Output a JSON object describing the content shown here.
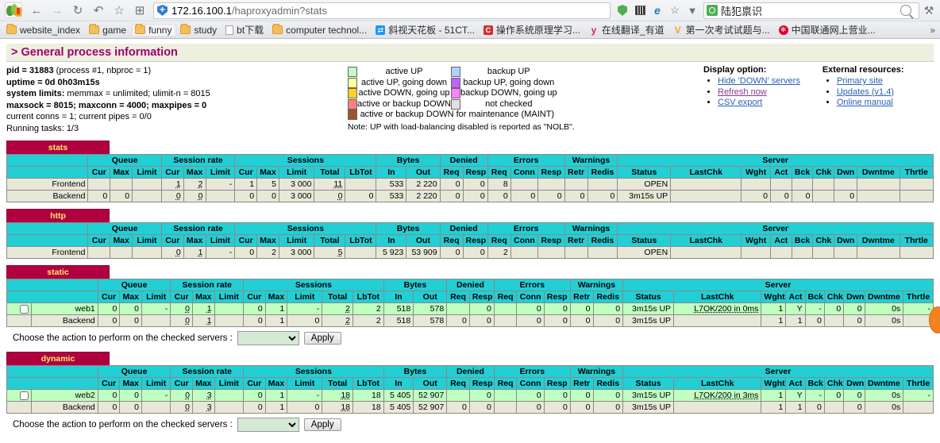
{
  "browser": {
    "nav": {
      "back": "←",
      "forward": "→",
      "reload": "↻",
      "undo": "↶",
      "star": "☆",
      "apps": "⊞"
    },
    "url_host": "172.16.100.1",
    "url_path": "/haproxyadmin?stats",
    "search_value": "陆犯禀识",
    "dropdown_caret": "▼",
    "wrench": "⚒",
    "overflow": "»",
    "bookmarks": [
      {
        "label": "website_index",
        "icon": "folder-icon",
        "selected": false
      },
      {
        "label": "game",
        "icon": "folder-icon",
        "selected": false
      },
      {
        "label": "funny",
        "icon": "folder-icon",
        "selected": true
      },
      {
        "label": "study",
        "icon": "folder-icon",
        "selected": false
      },
      {
        "label": "bt下载",
        "icon": "page-icon",
        "selected": false
      },
      {
        "label": "computer technol...",
        "icon": "folder-icon",
        "selected": false
      },
      {
        "label": "斜视天花板 - 51CT...",
        "icon": "favicon-blue",
        "selected": false
      },
      {
        "label": "操作系统原理学习...",
        "icon": "favicon-red",
        "selected": false
      },
      {
        "label": "在线翻译_有道",
        "icon": "favicon-youdao",
        "selected": false
      },
      {
        "label": "第一次考试试题与...",
        "icon": "favicon-v",
        "selected": false
      },
      {
        "label": "中国联通网上营业...",
        "icon": "favicon-unicom",
        "selected": false
      }
    ]
  },
  "page": {
    "section_title": "> General process information",
    "process_info": [
      {
        "bold": "pid = 31883",
        "rest": " (process #1, nbproc = 1)"
      },
      {
        "bold": "uptime = 0d 0h03m15s",
        "rest": ""
      },
      {
        "bold": "system limits:",
        "rest": " memmax = unlimited; ulimit-n = 8015"
      },
      {
        "bold": "maxsock = 8015; maxconn = 4000; maxpipes = 0",
        "rest": ""
      },
      {
        "bold": "",
        "rest": "current conns = 1; current pipes = 0/0"
      },
      {
        "bold": "",
        "rest": "Running tasks: 1/3"
      }
    ],
    "legend": {
      "left": [
        {
          "color": "#c0ffc0",
          "label": "active UP"
        },
        {
          "color": "#ffffa0",
          "label": "active UP, going down"
        },
        {
          "color": "#ffd020",
          "label": "active DOWN, going up"
        },
        {
          "color": "#ff8080",
          "label": "active or backup DOWN"
        },
        {
          "color": "#a0522d",
          "label": "active or backup DOWN for maintenance (MAINT)"
        }
      ],
      "right": [
        {
          "color": "#b0d0ff",
          "label": "backup UP"
        },
        {
          "color": "#c060ff",
          "label": "backup UP, going down"
        },
        {
          "color": "#ff80ff",
          "label": "backup DOWN, going up"
        },
        {
          "color": "#e0e0e0",
          "label": "not checked"
        }
      ],
      "note": "Note: UP with load-balancing disabled is reported as \"NOLB\"."
    },
    "display_option": {
      "title": "Display option:",
      "links": [
        "Hide 'DOWN' servers",
        "Refresh now",
        "CSV export"
      ]
    },
    "external_resources": {
      "title": "External resources:",
      "links": [
        "Primary site",
        "Updates (v1.4)",
        "Online manual"
      ]
    },
    "group_headers": [
      "Queue",
      "Session rate",
      "Sessions",
      "Bytes",
      "Denied",
      "Errors",
      "Warnings",
      "Server"
    ],
    "col_headers": [
      "Cur",
      "Max",
      "Limit",
      "Cur",
      "Max",
      "Limit",
      "Cur",
      "Max",
      "Limit",
      "Total",
      "LbTot",
      "In",
      "Out",
      "Req",
      "Resp",
      "Req",
      "Conn",
      "Resp",
      "Retr",
      "Redis",
      "Status",
      "LastChk",
      "Wght",
      "Act",
      "Bck",
      "Chk",
      "Dwn",
      "Dwntme",
      "Thrtle"
    ],
    "action_prompt": "Choose the action to perform on the checked servers :",
    "apply_label": "Apply",
    "select_value": ""
  },
  "proxies": [
    {
      "name": "stats",
      "has_checkbox_col": false,
      "rows": [
        {
          "kind": "frontend",
          "green": false,
          "label": "Frontend",
          "checkbox": null,
          "cells": [
            "",
            "",
            "",
            "1",
            "2",
            "-",
            "1",
            "5",
            "3 000",
            "11",
            "",
            "533",
            "2 220",
            "0",
            "0",
            "8",
            "",
            "",
            "",
            "",
            "OPEN",
            "",
            "",
            "",
            "",
            "",
            "",
            "",
            ""
          ]
        },
        {
          "kind": "backend",
          "green": false,
          "label": "Backend",
          "checkbox": null,
          "cells": [
            "0",
            "0",
            "",
            "0",
            "0",
            "",
            "0",
            "0",
            "3 000",
            "0",
            "0",
            "533",
            "2 220",
            "0",
            "0",
            "0",
            "0",
            "0",
            "0",
            "0",
            "3m15s UP",
            "",
            "0",
            "0",
            "0",
            "",
            "0",
            "",
            ""
          ]
        }
      ],
      "action_row": false
    },
    {
      "name": "http",
      "has_checkbox_col": false,
      "rows": [
        {
          "kind": "frontend",
          "green": false,
          "label": "Frontend",
          "checkbox": null,
          "cells": [
            "",
            "",
            "",
            "0",
            "1",
            "-",
            "0",
            "2",
            "3 000",
            "5",
            "",
            "5 923",
            "53 909",
            "0",
            "0",
            "2",
            "",
            "",
            "",
            "",
            "OPEN",
            "",
            "",
            "",
            "",
            "",
            "",
            "",
            ""
          ]
        }
      ],
      "action_row": false
    },
    {
      "name": "static",
      "has_checkbox_col": true,
      "rows": [
        {
          "kind": "server",
          "green": true,
          "label": "web1",
          "checkbox": false,
          "cells": [
            "0",
            "0",
            "-",
            "0",
            "1",
            "",
            "0",
            "1",
            "-",
            "2",
            "2",
            "518",
            "578",
            "",
            "0",
            "",
            "0",
            "0",
            "0",
            "0",
            "3m15s UP",
            "L7OK/200 in 0ms",
            "1",
            "Y",
            "-",
            "0",
            "0",
            "0s",
            "-"
          ]
        },
        {
          "kind": "backend",
          "green": false,
          "label": "Backend",
          "checkbox": null,
          "cells": [
            "0",
            "0",
            "",
            "0",
            "1",
            "",
            "0",
            "1",
            "0",
            "2",
            "2",
            "518",
            "578",
            "0",
            "0",
            "",
            "0",
            "0",
            "0",
            "0",
            "3m15s UP",
            "",
            "1",
            "1",
            "0",
            "",
            "0",
            "0s",
            ""
          ]
        }
      ],
      "action_row": true
    },
    {
      "name": "dynamic",
      "has_checkbox_col": true,
      "rows": [
        {
          "kind": "server",
          "green": true,
          "label": "web2",
          "checkbox": false,
          "cells": [
            "0",
            "0",
            "-",
            "0",
            "3",
            "",
            "0",
            "1",
            "-",
            "18",
            "18",
            "5 405",
            "52 907",
            "",
            "0",
            "",
            "0",
            "0",
            "0",
            "0",
            "3m15s UP",
            "L7OK/200 in 3ms",
            "1",
            "Y",
            "-",
            "0",
            "0",
            "0s",
            "-"
          ]
        },
        {
          "kind": "backend",
          "green": false,
          "label": "Backend",
          "checkbox": null,
          "cells": [
            "0",
            "0",
            "",
            "0",
            "3",
            "",
            "0",
            "1",
            "0",
            "18",
            "18",
            "5 405",
            "52 907",
            "0",
            "0",
            "",
            "0",
            "0",
            "0",
            "0",
            "3m15s UP",
            "",
            "1",
            "1",
            "0",
            "",
            "0",
            "0s",
            ""
          ]
        }
      ],
      "action_row": true
    }
  ]
}
